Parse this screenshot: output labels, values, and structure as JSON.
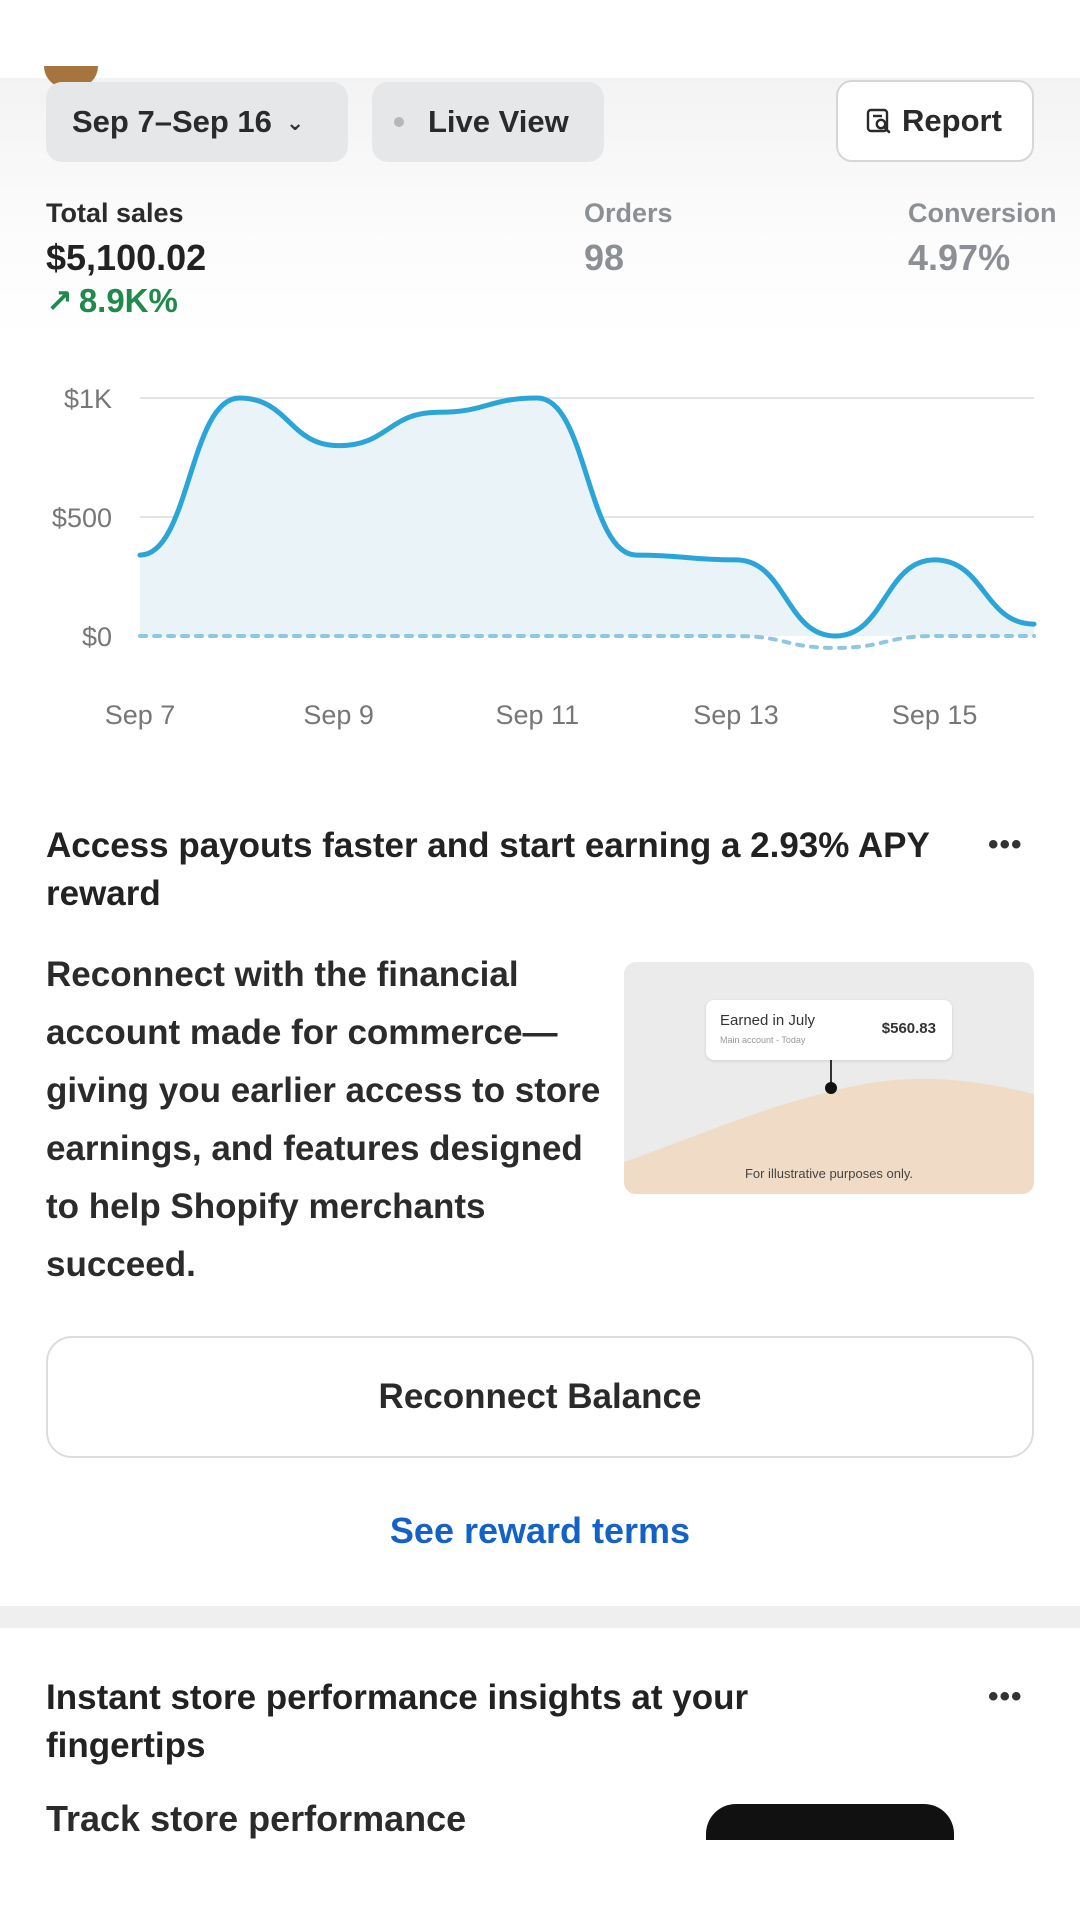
{
  "toolbar": {
    "date_range": "Sep 7–Sep 16",
    "live_view": "Live View",
    "report": "Report"
  },
  "metrics": {
    "total_sales": {
      "label": "Total sales",
      "value": "$5,100.02",
      "change": "8.9K%"
    },
    "orders": {
      "label": "Orders",
      "value": "98"
    },
    "conversion": {
      "label": "Conversion",
      "value": "4.97%"
    }
  },
  "chart_data": {
    "type": "line",
    "x": [
      "Sep 7",
      "Sep 8",
      "Sep 9",
      "Sep 10",
      "Sep 11",
      "Sep 12",
      "Sep 13",
      "Sep 14",
      "Sep 15",
      "Sep 16"
    ],
    "series": [
      {
        "values": [
          340,
          1000,
          800,
          940,
          1000,
          340,
          320,
          0,
          320,
          50
        ]
      },
      {
        "values": [
          0,
          0,
          0,
          0,
          0,
          0,
          0,
          -50,
          0,
          0
        ]
      }
    ],
    "x_tick_labels": [
      "Sep 7",
      "Sep 9",
      "Sep 11",
      "Sep 13",
      "Sep 15"
    ],
    "y_tick_labels": [
      "$0",
      "$500",
      "$1K"
    ],
    "ylim": [
      0,
      1000
    ],
    "grid": true,
    "colors": {
      "line": "#2ba5d8",
      "fill": "#eaf3f8",
      "comparison": "#8fc7e3"
    }
  },
  "payout_card": {
    "title": "Access payouts faster and start earning a 2.93% APY reward",
    "body": "Reconnect with the financial account made for commerce—giving you earlier access to store earnings, and features designed to help Shopify merchants succeed.",
    "illustration": {
      "card_title": "Earned in July",
      "card_subtitle": "Main account - Today",
      "card_value": "$560.83",
      "note": "For illustrative purposes only."
    },
    "button": "Reconnect Balance",
    "link": "See reward terms"
  },
  "insights_card": {
    "title": "Instant store performance insights at your fingertips",
    "body_start": "Track store performance"
  },
  "icons": {
    "more": "more-horizontal-icon",
    "chevron": "chevron-down-icon",
    "report": "report-search-icon",
    "trend": "arrow-up-right-icon"
  }
}
